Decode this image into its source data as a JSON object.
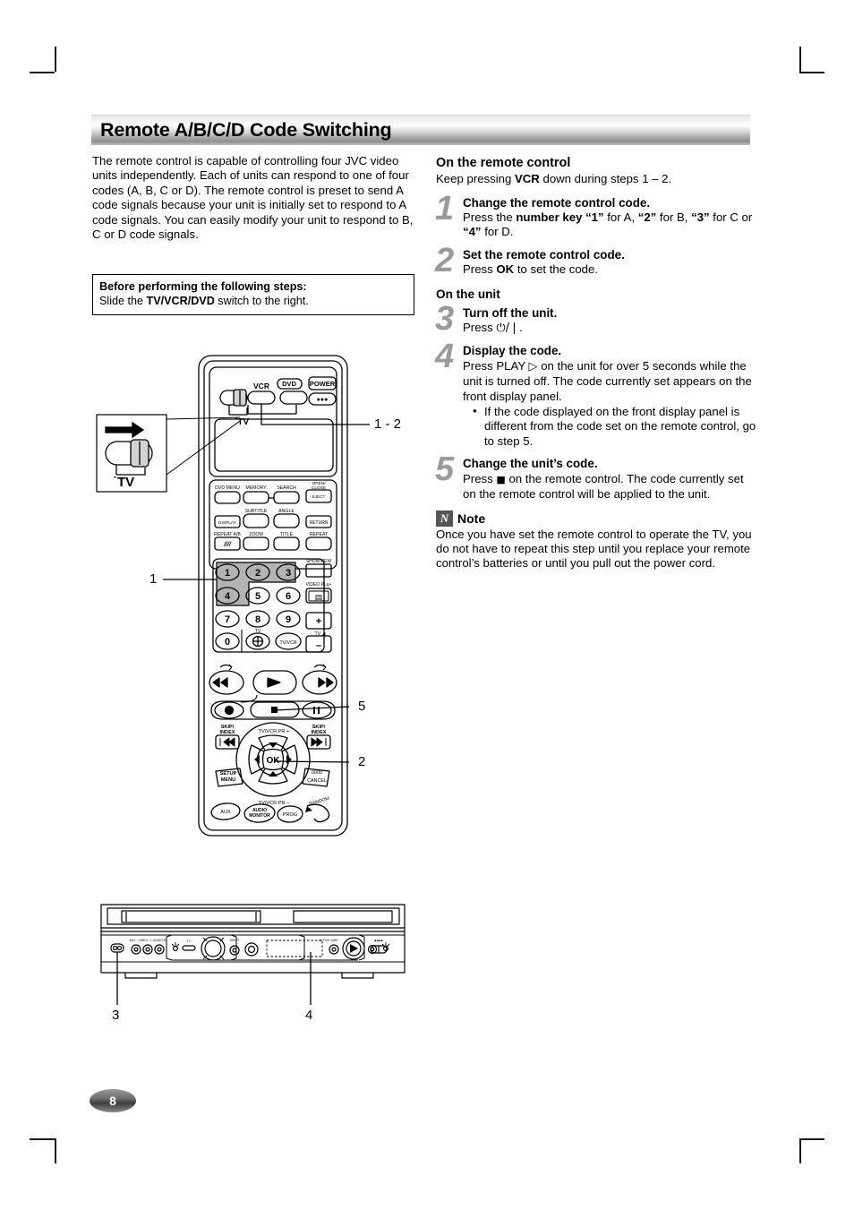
{
  "page": {
    "number": "8",
    "title": "Remote A/B/C/D Code Switching"
  },
  "intro": {
    "paragraph": "The remote control is capable of controlling four JVC video units independently. Each of units can respond to one of four codes (A, B, C or D). The remote control is preset to send A code signals because your unit is initially set to respond to A code signals. You can easily modify your unit to respond to B, C or D code signals."
  },
  "before_box": {
    "heading": "Before performing the following steps:",
    "line_pre": "Slide the ",
    "line_bold": "TV/VCR/DVD",
    "line_post": " switch to the right."
  },
  "remote_section": {
    "heading": "On the remote control",
    "subtext_pre": "Keep pressing ",
    "subtext_bold": "VCR",
    "subtext_post": " down during steps 1 – 2.",
    "steps": [
      {
        "num": "1",
        "title": "Change the remote control code.",
        "body_1": "Press the ",
        "body_bold_1": "number key “1”",
        "body_2": " for A, ",
        "body_bold_2": "“2”",
        "body_3": " for B, ",
        "body_bold_3": "“3”",
        "body_4": " for C or ",
        "body_bold_4": "“4”",
        "body_5": " for D."
      },
      {
        "num": "2",
        "title": "Set the remote control code.",
        "body_1": "Press ",
        "body_bold_1": "OK",
        "body_2": " to set the code."
      }
    ]
  },
  "unit_section": {
    "heading": "On the unit",
    "steps": [
      {
        "num": "3",
        "title": "Turn off the unit.",
        "body_1": "Press ",
        "glyph": "⏻/❘",
        "body_2": "."
      },
      {
        "num": "4",
        "title": "Display the code.",
        "body_1": "Press PLAY ",
        "glyph": "▷",
        "body_2": "  on the unit for over 5 seconds while the unit is turned off. The code currently set appears on the front display panel.",
        "bullets": [
          "If the code displayed on the front display panel is different from the code set on the remote control, go to step 5."
        ]
      },
      {
        "num": "5",
        "title": "Change the unit’s code.",
        "body_1": "Press ",
        "glyph": "■",
        "body_2": " on the remote control. The code currently set on the remote control will be applied to the unit."
      }
    ]
  },
  "note": {
    "badge": "N",
    "label": "Note",
    "body": "Once you have set the remote control to operate the TV, you do not have to repeat this step until you replace your remote control’s batteries or until you pull out the power cord."
  },
  "remote_figure": {
    "switch_label": "TV",
    "switch_dot": "˙",
    "top_buttons": [
      "VCR",
      "DVD",
      "POWER"
    ],
    "power_dots": "●●●",
    "row1": [
      "DVD MENU",
      "MEMORY",
      "SEARCH",
      "OPEN/",
      "CLOSE",
      "EJECT"
    ],
    "row2_top": [
      "SUBTITLE",
      "ANGLE"
    ],
    "row2": [
      "DISPLAY",
      "RETURN"
    ],
    "row3_top": [
      "REPEAT A/B",
      "ZOOM",
      "TITLE",
      "REPEAT"
    ],
    "repeat_ab_glyph": "////",
    "numpad": [
      "1",
      "2",
      "3",
      "4",
      "5",
      "6",
      "7",
      "8",
      "9",
      "0"
    ],
    "tv_input_label": "TV",
    "tv_input_glyph": "⊕",
    "tvvcr_label": "TV/VCR",
    "showview": "SHOWVIEW",
    "videoplus": "VIDEO PLų+",
    "videoplus_glyph": "☷",
    "vol_plus": "+",
    "vol_minus": "–",
    "vol_label": "TV",
    "vol_glyph": "◢",
    "skip_index": "SKIP/\nINDEX",
    "skip_prev_glyph": "⏮",
    "skip_next_glyph": "⏭",
    "play_glyph": "▶",
    "rew_glyph": "◀◀",
    "ff_glyph": "▶▶",
    "rec_glyph": "●",
    "stop_glyph": "■",
    "pause_glyph": "‖",
    "pr_plus": "˙TV/VCR PR +",
    "pr_minus": "˙TV/VCR PR –",
    "ok": "OK",
    "setup_menu": "SETUP\nMENU",
    "cancel_top": "0000",
    "cancel": "CANCEL",
    "random": "RANDOM",
    "aux": "AUX",
    "audio_monitor": "AUDIO\nMONITOR",
    "prog": "PROG"
  },
  "callouts": {
    "one_two": "1 - 2",
    "one": "1",
    "five": "5",
    "two": "2",
    "three": "3",
    "four": "4"
  },
  "colors": {
    "header_light": "#ffffff",
    "header_dark": "#8f8f8f",
    "step_number": "#9b9b9b",
    "highlight_gray": "#b3b3b3",
    "line": "#000000"
  }
}
